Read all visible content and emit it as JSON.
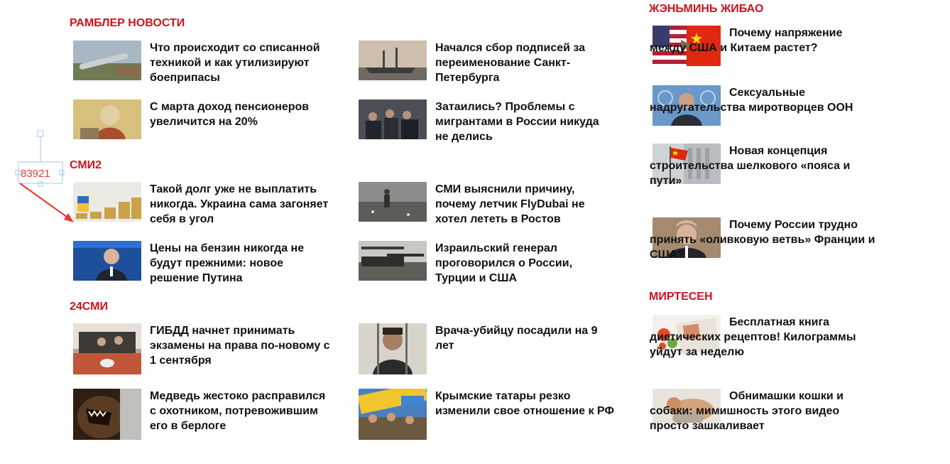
{
  "sections": {
    "rambler": {
      "title": "РАМБЛЕР НОВОСТИ"
    },
    "smi2": {
      "title": "СМИ2"
    },
    "smi24": {
      "title": "24СМИ"
    },
    "renmin": {
      "title": "ЖЭНЬМИНЬ ЖИБАО"
    },
    "mirtesen": {
      "title": "МИРТЕСЕН"
    }
  },
  "news": {
    "r1": "Что происходит со списанной техникой и как утилизируют боеприпасы",
    "r2": "Начался сбор подписей за переименование Санкт-Петербурга",
    "r3": "С марта доход пенсионеров увеличится на 20%",
    "r4": "Затаились? Проблемы с мигрантами в России никуда не делись",
    "s1": "Такой долг уже не выплатить никогда. Украина сама загоняет себя в угол",
    "s2": "СМИ выяснили причину, почему летчик FlyDubai не хотел лететь в Ростов",
    "s3": "Цены на бензин никогда не будут прежними: новое решение Путина",
    "s4": "Израильский генерал проговорился о России, Турции и США",
    "t1": "ГИБДД начнет принимать экзамены на права по-новому с 1 сентября",
    "t2": "Врача-убийцу посадили на 9 лет",
    "t3": "Медведь жестоко расправился с охотником, потревожившим его в берлоге",
    "t4": "Крымские татары резко изменили свое отношение к РФ",
    "p1": "Почему напряжение между США и Китаем растет?",
    "p2": "Сексуальные надругательства миротворцев ООН",
    "p3": "Новая концепция строительства шелкового «пояса и пути»",
    "p4": "Почему России трудно принять «оливковую ветвь» Франции и США?",
    "m1": "Бесплатная книга диетических рецептов! Килограммы уйдут за неделю",
    "m2": "Обнимашки кошки и собаки: мимишность этого видео просто зашкаливает"
  },
  "annotation": {
    "label": "83921"
  },
  "colors": {
    "section_title": "#d0121e",
    "marker": "#e53935"
  }
}
